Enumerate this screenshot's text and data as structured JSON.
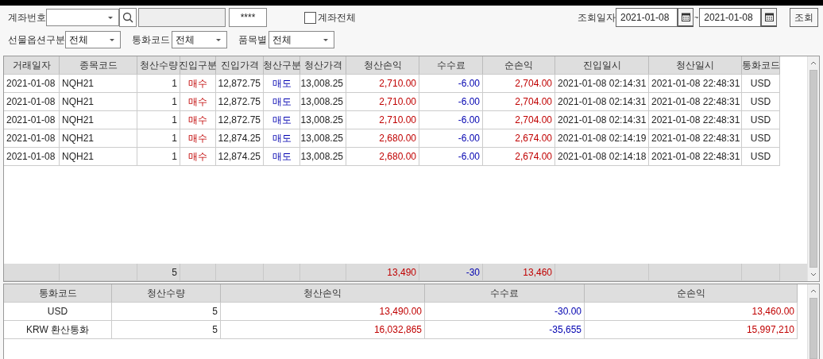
{
  "filters": {
    "account": {
      "label": "계좌번호"
    },
    "password": "****",
    "all_accounts": {
      "label": "계좌전체",
      "checked": false
    },
    "date": {
      "label": "조회일자",
      "from": "2021-01-08",
      "separator": "~",
      "to": "2021-01-08"
    },
    "search_button": "조회",
    "futures_option": {
      "label": "선물옵션구분",
      "value": "전체"
    },
    "currency": {
      "label": "통화코드",
      "value": "전체"
    },
    "product": {
      "label": "품목별",
      "value": "전체"
    }
  },
  "trades": {
    "columns": [
      "거래일자",
      "종목코드",
      "청산수량",
      "진입구분",
      "진입가격",
      "청산구분",
      "청산가격",
      "청산손익",
      "수수료",
      "순손익",
      "진입일시",
      "청산일시",
      "통화코드"
    ],
    "rows": [
      {
        "date": "2021-01-08",
        "code": "NQH21",
        "qty": "1",
        "entry": {
          "text": "매수",
          "kind": "buy"
        },
        "entry_price": "12,872.75",
        "exit": {
          "text": "매도",
          "kind": "sell"
        },
        "exit_price": "13,008.25",
        "pnl": "2,710.00",
        "fee": "-6.00",
        "net": "2,704.00",
        "entry_time": "2021-01-08 02:14:31",
        "exit_time": "2021-01-08 22:48:31",
        "currency": "USD"
      },
      {
        "date": "2021-01-08",
        "code": "NQH21",
        "qty": "1",
        "entry": {
          "text": "매수",
          "kind": "buy"
        },
        "entry_price": "12,872.75",
        "exit": {
          "text": "매도",
          "kind": "sell"
        },
        "exit_price": "13,008.25",
        "pnl": "2,710.00",
        "fee": "-6.00",
        "net": "2,704.00",
        "entry_time": "2021-01-08 02:14:31",
        "exit_time": "2021-01-08 22:48:31",
        "currency": "USD"
      },
      {
        "date": "2021-01-08",
        "code": "NQH21",
        "qty": "1",
        "entry": {
          "text": "매수",
          "kind": "buy"
        },
        "entry_price": "12,872.75",
        "exit": {
          "text": "매도",
          "kind": "sell"
        },
        "exit_price": "13,008.25",
        "pnl": "2,710.00",
        "fee": "-6.00",
        "net": "2,704.00",
        "entry_time": "2021-01-08 02:14:31",
        "exit_time": "2021-01-08 22:48:31",
        "currency": "USD"
      },
      {
        "date": "2021-01-08",
        "code": "NQH21",
        "qty": "1",
        "entry": {
          "text": "매수",
          "kind": "buy"
        },
        "entry_price": "12,874.25",
        "exit": {
          "text": "매도",
          "kind": "sell"
        },
        "exit_price": "13,008.25",
        "pnl": "2,680.00",
        "fee": "-6.00",
        "net": "2,674.00",
        "entry_time": "2021-01-08 02:14:19",
        "exit_time": "2021-01-08 22:48:31",
        "currency": "USD"
      },
      {
        "date": "2021-01-08",
        "code": "NQH21",
        "qty": "1",
        "entry": {
          "text": "매수",
          "kind": "buy"
        },
        "entry_price": "12,874.25",
        "exit": {
          "text": "매도",
          "kind": "sell"
        },
        "exit_price": "13,008.25",
        "pnl": "2,680.00",
        "fee": "-6.00",
        "net": "2,674.00",
        "entry_time": "2021-01-08 02:14:18",
        "exit_time": "2021-01-08 22:48:31",
        "currency": "USD"
      }
    ],
    "totals": {
      "qty": "5",
      "pnl": "13,490",
      "fee": "-30",
      "net": "13,460"
    }
  },
  "summary": {
    "columns": [
      "통화코드",
      "청산수량",
      "청산손익",
      "수수료",
      "순손익"
    ],
    "rows": [
      {
        "currency": "USD",
        "qty": "5",
        "pnl": "13,490.00",
        "fee": "-30.00",
        "net": "13,460.00"
      },
      {
        "currency": "KRW 환산통화",
        "qty": "5",
        "pnl": "16,032,865",
        "fee": "-35,655",
        "net": "15,997,210"
      }
    ]
  }
}
